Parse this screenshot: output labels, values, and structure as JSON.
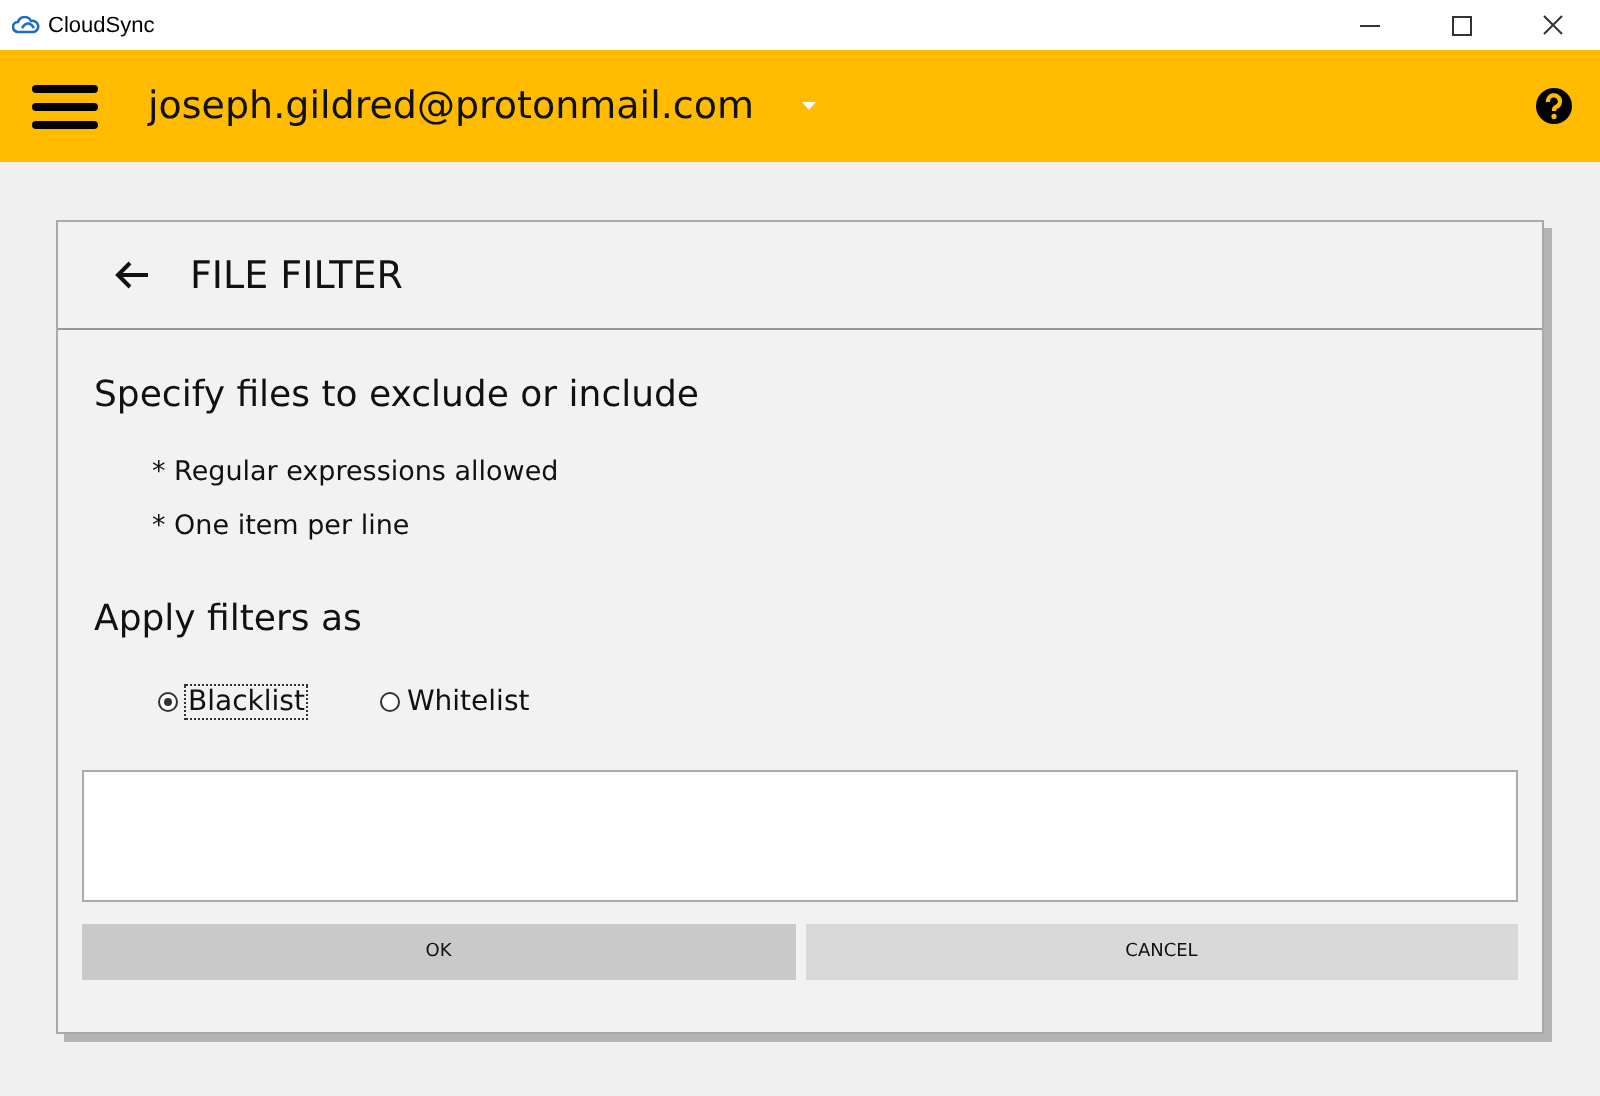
{
  "window": {
    "title": "CloudSync"
  },
  "header": {
    "account": "joseph.gildred@protonmail.com"
  },
  "page": {
    "title": "FILE FILTER",
    "heading": "Specify files to exclude or include",
    "notes": [
      "* Regular expressions allowed",
      "* One item per line"
    ],
    "mode_label": "Apply filters as",
    "modes": [
      {
        "label": "Blacklist",
        "selected": true
      },
      {
        "label": "Whitelist",
        "selected": false
      }
    ]
  },
  "buttons": [
    {
      "label": "OK",
      "kind": "default"
    },
    {
      "label": "CANCEL",
      "kind": "normal"
    }
  ]
}
